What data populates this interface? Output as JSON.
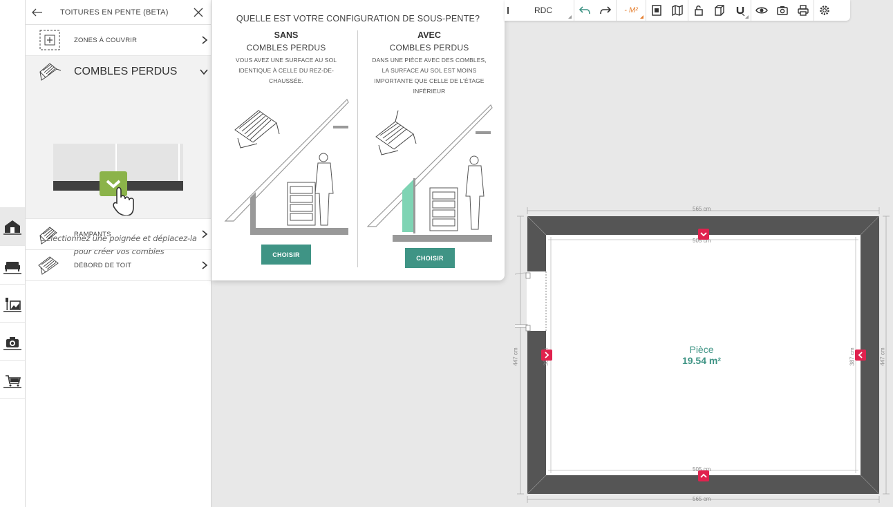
{
  "panel": {
    "title": "TOITURES EN PENTE (BETA)",
    "items": [
      {
        "label": "ZONES À COUVRIR"
      },
      {
        "label": "COMBLES PERDUS"
      },
      {
        "label": "RAMPANTS"
      },
      {
        "label": "DÉBORD DE TOIT"
      }
    ],
    "hint": "Sélectionnez une poignée et déplacez-la pour créer vos combles"
  },
  "modal": {
    "title": "QUELLE EST VOTRE CONFIGURATION DE SOUS-PENTE?",
    "left": {
      "heading": "SANS",
      "subheading": "COMBLES PERDUS",
      "description": "VOUS AVEZ UNE SURFACE AU SOL IDENTIQUE À CELLE DU REZ-DE-CHAUSSÉE.",
      "button": "CHOISIR"
    },
    "right": {
      "heading": "AVEC",
      "subheading": "COMBLES PERDUS",
      "description": "DANS UNE PIÈCE AVEC DES COMBLES, LA SURFACE AU SOL EST MOINS IMPORTANTE QUE CELLE DE L'ÉTAGE INFÉRIEUR",
      "button": "CHOISIR"
    }
  },
  "toolbar": {
    "level": "RDC",
    "unit": "- M²"
  },
  "plan": {
    "room_name": "Pièce",
    "room_area": "19.54 m²",
    "dims": {
      "top_outer": "565 cm",
      "top_inner": "505 cm",
      "bottom_outer": "565 cm",
      "bottom_inner": "505 cm",
      "left_outer": "447 cm",
      "left_inner": "387 cm",
      "right_outer": "447 cm",
      "right_inner": "387 cm"
    }
  },
  "colors": {
    "accent": "#3f9485",
    "handle": "#e0224e",
    "wall": "#555555",
    "check_green": "#8bb34a"
  }
}
